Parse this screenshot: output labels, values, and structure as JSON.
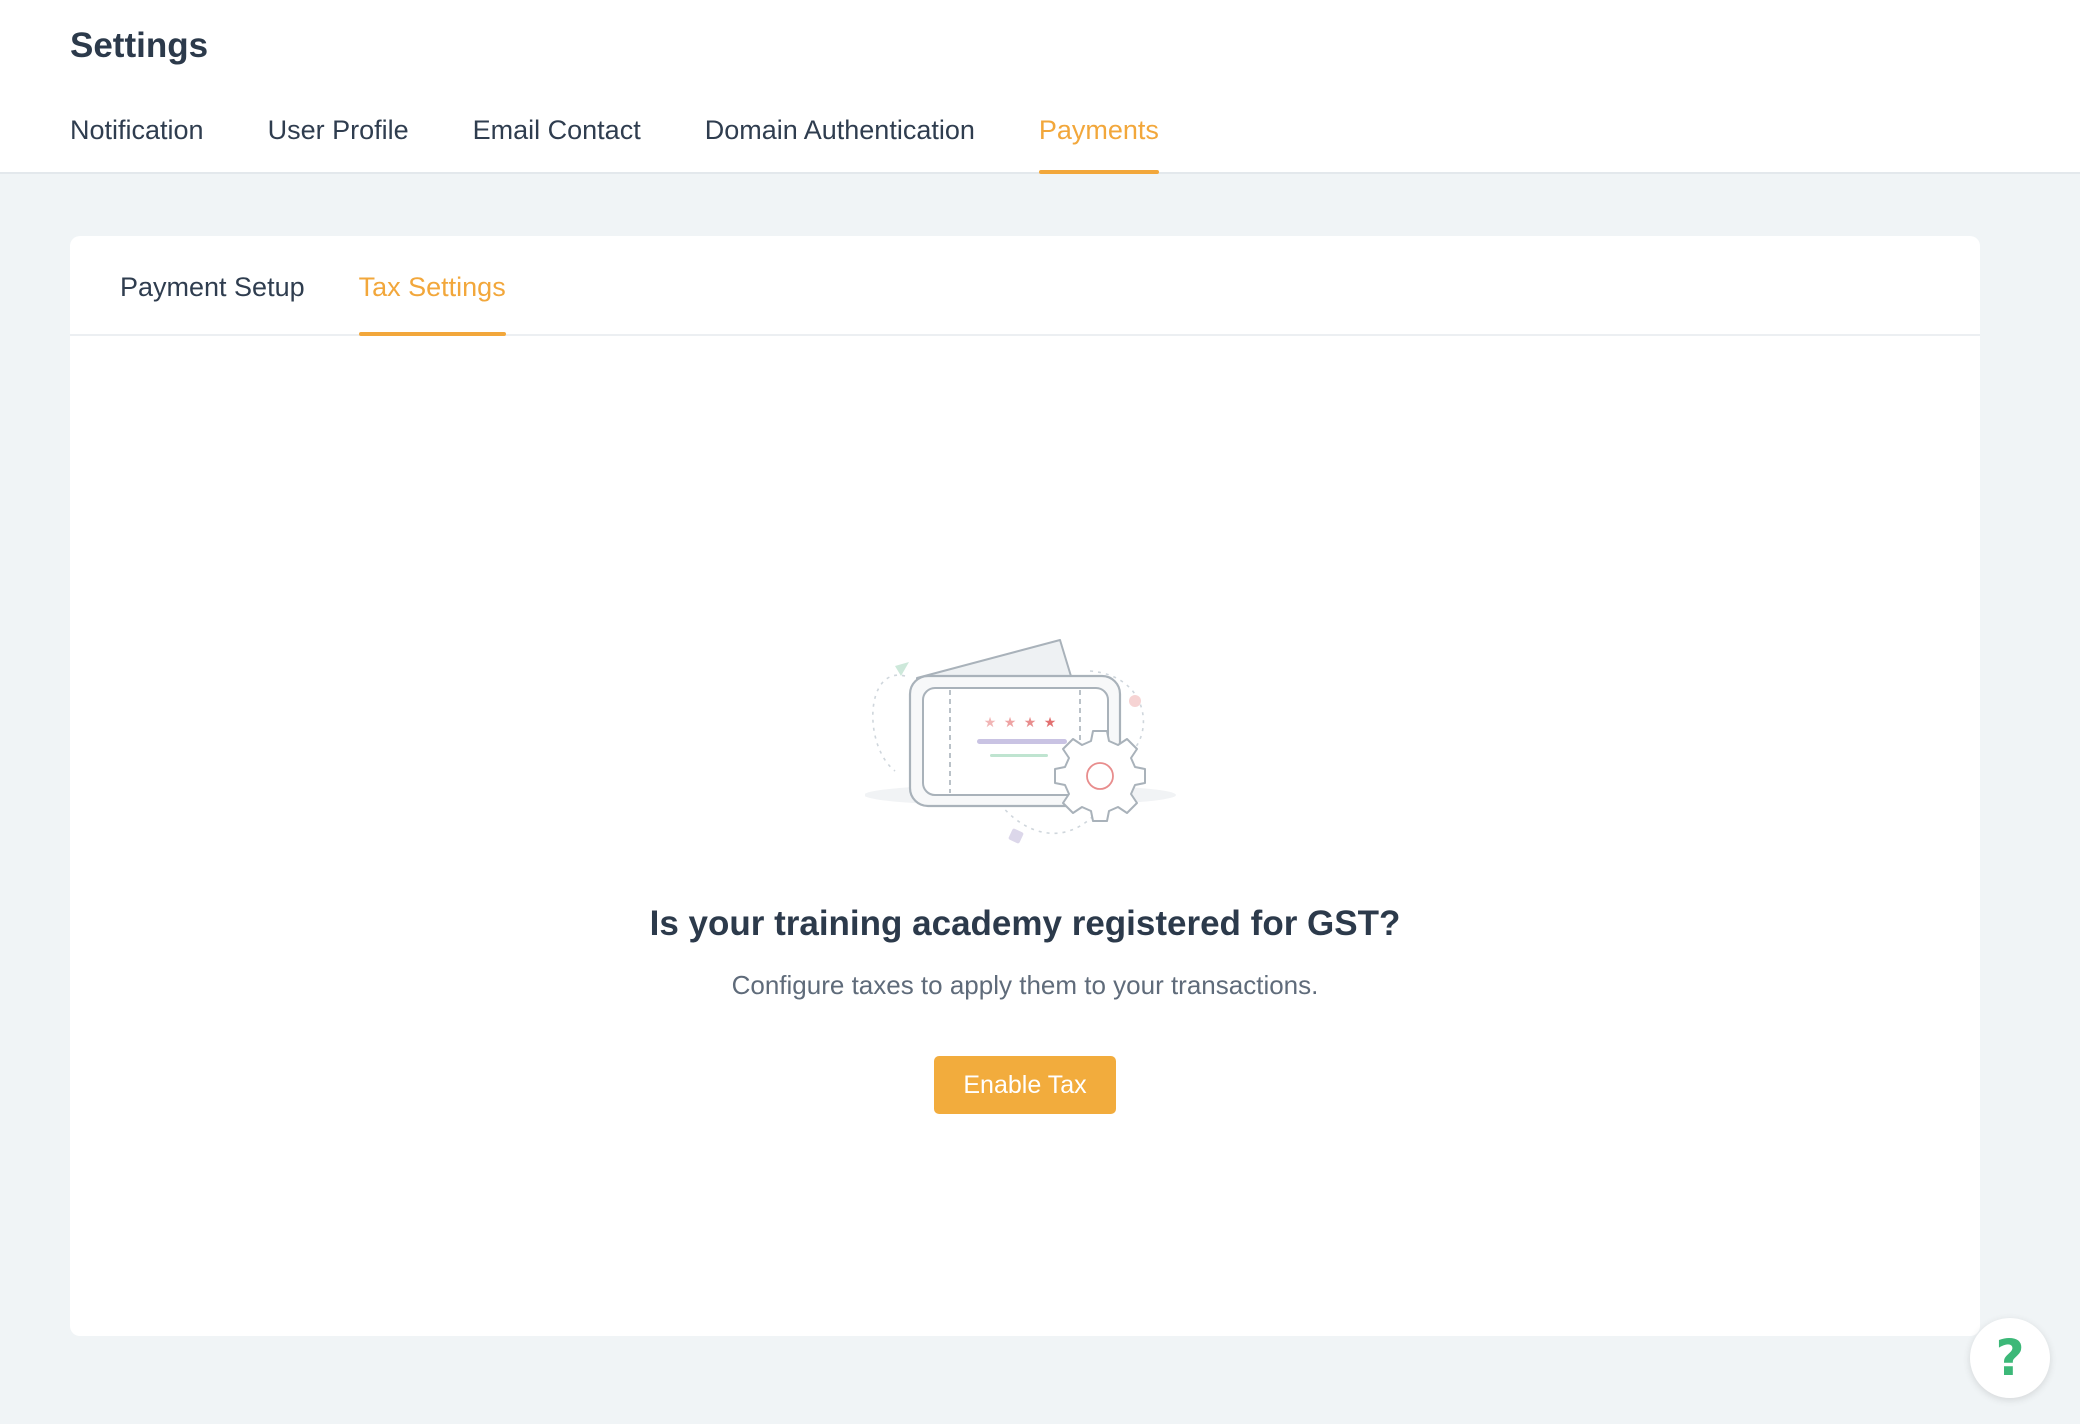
{
  "header": {
    "title": "Settings",
    "tabs": [
      {
        "label": "Notification",
        "active": false
      },
      {
        "label": "User Profile",
        "active": false
      },
      {
        "label": "Email Contact",
        "active": false
      },
      {
        "label": "Domain Authentication",
        "active": false
      },
      {
        "label": "Payments",
        "active": true
      }
    ]
  },
  "payments": {
    "tabs": [
      {
        "label": "Payment Setup",
        "active": false
      },
      {
        "label": "Tax Settings",
        "active": true
      }
    ],
    "empty_state": {
      "illustration_icon": "wallet-gear-icon",
      "heading": "Is your training academy registered for GST?",
      "description": "Configure taxes to apply them to your transactions.",
      "button_label": "Enable Tax"
    }
  },
  "help": {
    "icon": "help-icon",
    "glyph": "?"
  },
  "colors": {
    "accent": "#f2a73b",
    "help": "#3cb878",
    "text": "#2f3d4f",
    "background": "#f0f4f6"
  }
}
